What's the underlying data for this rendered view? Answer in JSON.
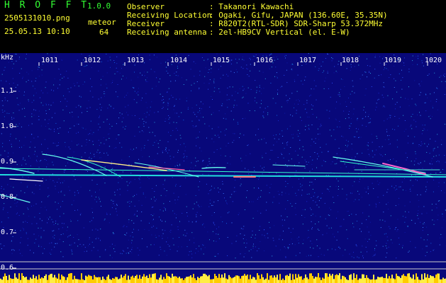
{
  "app": {
    "logo": "H R O F F T",
    "version": "1.0.0",
    "filename": "2505131010.png",
    "datetime": "25.05.13 10:10",
    "detect_label": "meteor",
    "detect_count": "64"
  },
  "info": {
    "rows": [
      {
        "label": "Observer",
        "value": ": Takanori Kawachi"
      },
      {
        "label": "Receiving Location",
        "value": ": Ogaki, Gifu, JAPAN (136.60E, 35.35N)"
      },
      {
        "label": "Receiver",
        "value": ": R820T2(RTL-SDR) SDR-Sharp 53.372MHz"
      },
      {
        "label": "Receiving antenna",
        "value": ": 2el-HB9CV Vertical (el. E-W)"
      }
    ]
  },
  "axis": {
    "unit": "kHz",
    "time_ticks": [
      "1011",
      "1012",
      "1013",
      "1014",
      "1015",
      "1016",
      "1017",
      "1018",
      "1019",
      "1020"
    ],
    "freq_ticks": [
      "1.1",
      "1.0",
      "0.9",
      "0.8",
      "0.7",
      "0.6"
    ]
  },
  "colors": {
    "header_green": "#33ff33",
    "header_yellow": "#ffff33",
    "background_blue": "#0a0a8c",
    "signal": "#33ffcc",
    "level_bar": "#ffcc00"
  }
}
